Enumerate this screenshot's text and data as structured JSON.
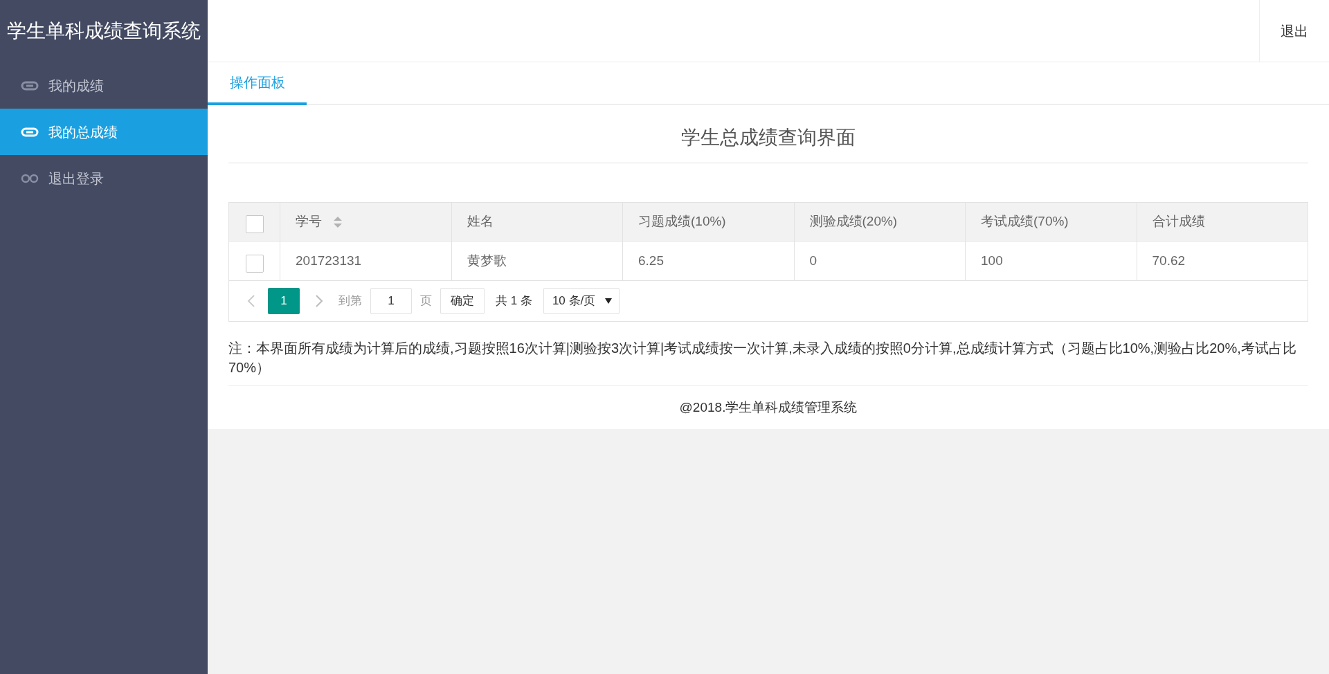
{
  "sidebar": {
    "title": "学生单科成绩查询系统",
    "items": [
      {
        "label": "我的成绩",
        "selected": false,
        "kind": "link"
      },
      {
        "label": "我的总成绩",
        "selected": true,
        "kind": "link"
      },
      {
        "label": "退出登录",
        "selected": false,
        "kind": "logout"
      }
    ]
  },
  "header": {
    "logout": "退出"
  },
  "tabs": [
    {
      "label": "操作面板",
      "selected": true
    }
  ],
  "page_title": "学生总成绩查询界面",
  "table": {
    "columns": [
      {
        "label": "学号",
        "sortable": true
      },
      {
        "label": "姓名",
        "sortable": false
      },
      {
        "label": "习题成绩(10%)",
        "sortable": false
      },
      {
        "label": "测验成绩(20%)",
        "sortable": false
      },
      {
        "label": "考试成绩(70%)",
        "sortable": false
      },
      {
        "label": "合计成绩",
        "sortable": false
      }
    ],
    "header_checked": false,
    "rows": [
      {
        "checked": false,
        "cells": [
          "201723131",
          "黄梦歌",
          "6.25",
          "0",
          "100",
          "70.62"
        ]
      }
    ]
  },
  "pagination": {
    "pages": [
      {
        "label": "1",
        "selected": true
      }
    ],
    "goto_label": "到第",
    "goto_value": "1",
    "page_unit": "页",
    "confirm": "确定",
    "total": "共 1 条",
    "page_size": "10 条/页"
  },
  "note": "注：本界面所有成绩为计算后的成绩,习题按照16次计算|测验按3次计算|考试成绩按一次计算,未录入成绩的按照0分计算,总成绩计算方式（习题占比10%,测验占比20%,考试占比70%）",
  "footer": "@2018.学生单科成绩管理系统"
}
